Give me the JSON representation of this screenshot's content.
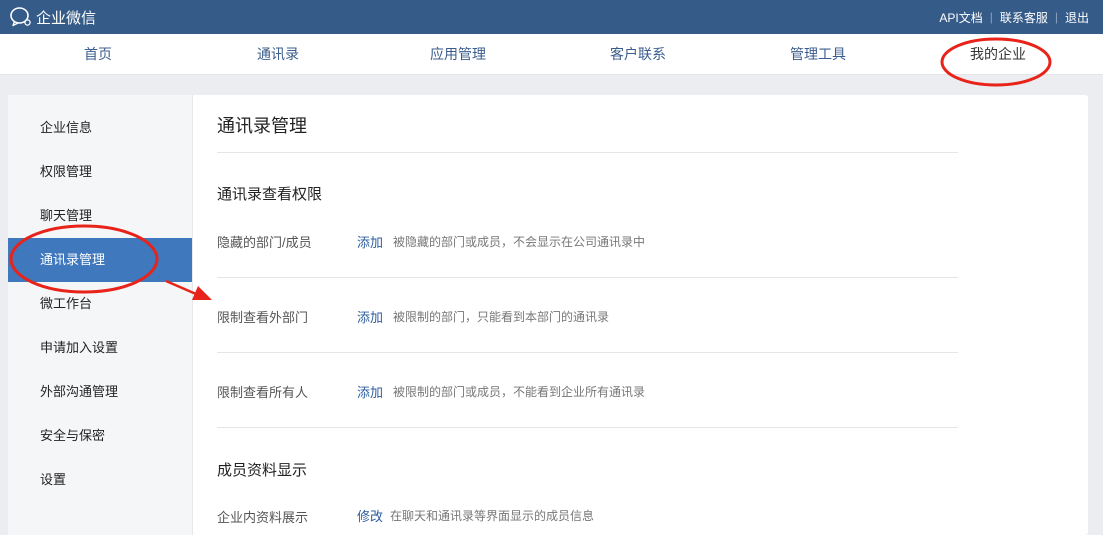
{
  "app": {
    "name": "企业微信"
  },
  "top_links": {
    "api_docs": "API文档",
    "contact_support": "联系客服",
    "logout": "退出",
    "separator": "|"
  },
  "nav": {
    "tabs": [
      {
        "label": "首页"
      },
      {
        "label": "通讯录"
      },
      {
        "label": "应用管理"
      },
      {
        "label": "客户联系"
      },
      {
        "label": "管理工具"
      },
      {
        "label": "我的企业",
        "active": true
      }
    ]
  },
  "sidebar": {
    "items": [
      {
        "label": "企业信息"
      },
      {
        "label": "权限管理"
      },
      {
        "label": "聊天管理"
      },
      {
        "label": "通讯录管理",
        "active": true
      },
      {
        "label": "微工作台"
      },
      {
        "label": "申请加入设置"
      },
      {
        "label": "外部沟通管理"
      },
      {
        "label": "安全与保密"
      },
      {
        "label": "设置"
      }
    ]
  },
  "main": {
    "title": "通讯录管理",
    "sections": [
      {
        "title": "通讯录查看权限",
        "rows": [
          {
            "label": "隐藏的部门/成员",
            "action": "添加",
            "desc": "被隐藏的部门或成员，不会显示在公司通讯录中"
          },
          {
            "label": "限制查看外部门",
            "action": "添加",
            "desc": "被限制的部门，只能看到本部门的通讯录"
          },
          {
            "label": "限制查看所有人",
            "action": "添加",
            "desc": "被限制的部门或成员，不能看到企业所有通讯录"
          }
        ]
      },
      {
        "title": "成员资料显示",
        "rows": [
          {
            "label": "企业内资料展示",
            "action": "修改",
            "desc": "在聊天和通讯录等界面显示的成员信息"
          }
        ]
      }
    ]
  },
  "colors": {
    "topbar": "#355b88",
    "nav_link": "#3b5d8c",
    "sidebar_active": "#3f78bd",
    "action_link": "#2d5ea0",
    "annotation_red": "#e8231a"
  },
  "icons": {
    "logo": "chat-bubble-logo-icon"
  }
}
